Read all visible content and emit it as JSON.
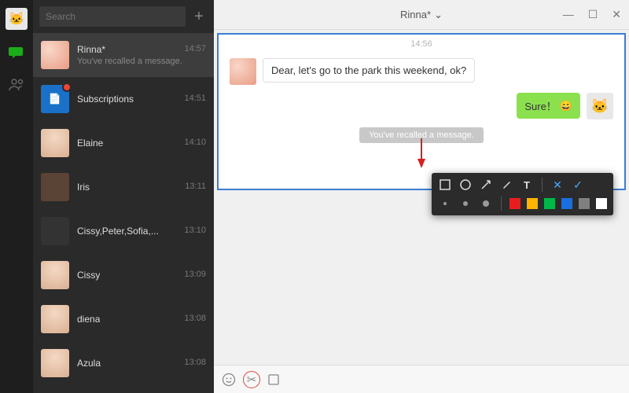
{
  "leftbar": {
    "chat_icon": "💬",
    "contacts_icon": "👥"
  },
  "sidebar": {
    "search_placeholder": "Search",
    "plus": "+",
    "items": [
      {
        "name": "Rinna*",
        "time": "14:57",
        "sub": "You've recalled a message."
      },
      {
        "name": "Subscriptions",
        "time": "14:51",
        "sub": ""
      },
      {
        "name": "Elaine",
        "time": "14:10",
        "sub": ""
      },
      {
        "name": "Iris",
        "time": "13:11",
        "sub": ""
      },
      {
        "name": "Cissy,Peter,Sofia,...",
        "time": "13:10",
        "sub": ""
      },
      {
        "name": "Cissy",
        "time": "13:09",
        "sub": ""
      },
      {
        "name": "diena",
        "time": "13:08",
        "sub": ""
      },
      {
        "name": "Azula",
        "time": "13:08",
        "sub": ""
      }
    ]
  },
  "titlebar": {
    "title": "Rinna*",
    "dropdown": "⌄",
    "min": "—",
    "max": "☐",
    "close": "✕"
  },
  "chat": {
    "timestamp": "14:56",
    "in_text": "Dear, let's go to the park this weekend, ok?",
    "out_text": "Sure！",
    "out_emoji": "😄",
    "recall_text": "You've recalled a message."
  },
  "annot": {
    "colors": [
      "#e81e1e",
      "#ffb400",
      "#00b84a",
      "#1a6fe0",
      "#808080",
      "#ffffff"
    ]
  }
}
